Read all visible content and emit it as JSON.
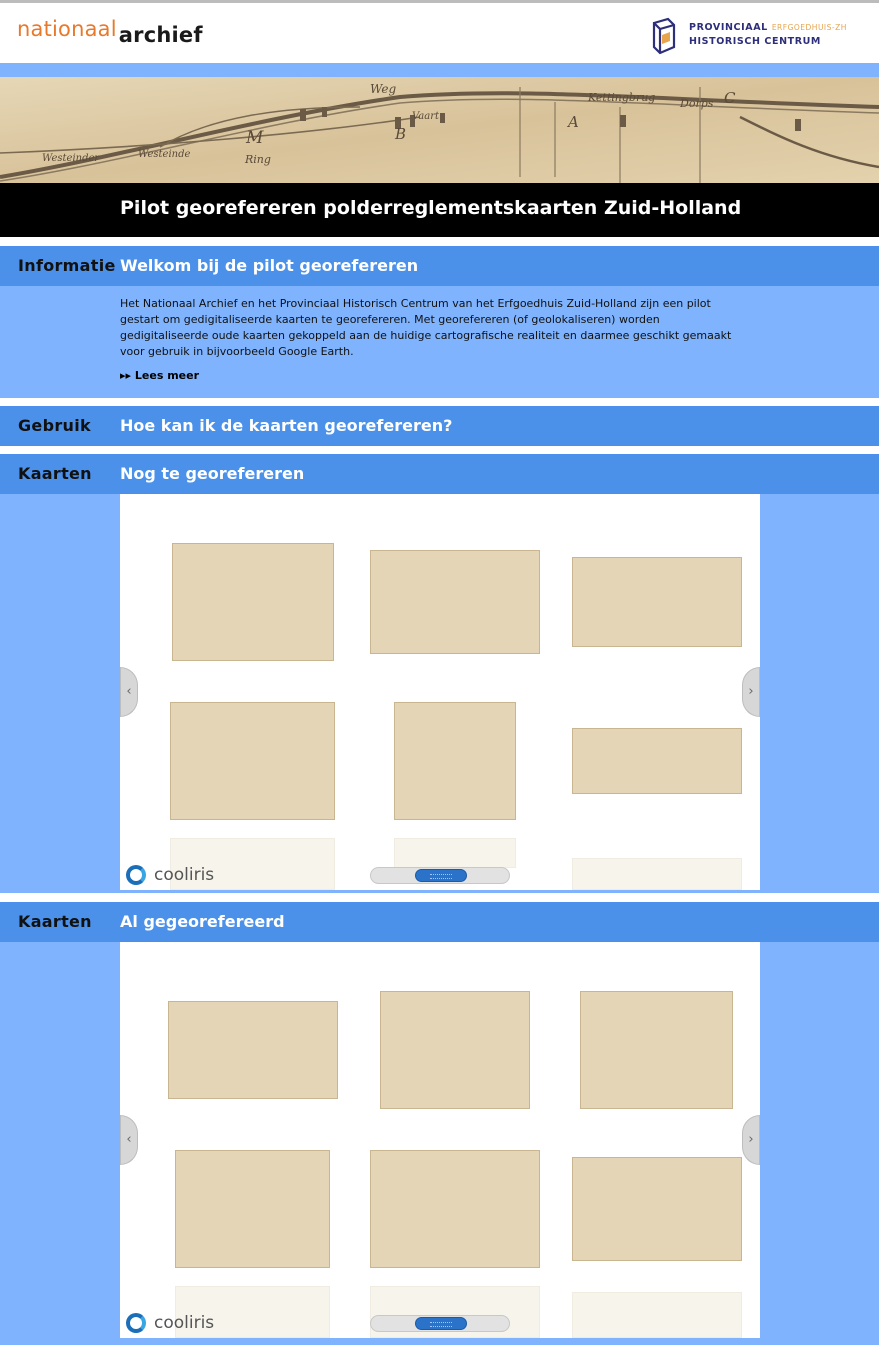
{
  "header": {
    "logo_part1": "nationaal",
    "logo_part2": "archief",
    "partner_line1": "PROVINCIAAL",
    "partner_sub": "ERFGOEDHUIS-ZH",
    "partner_line2": "HISTORISCH CENTRUM"
  },
  "banner": {
    "map_words": [
      "Weg",
      "Vaart",
      "Kettingbrug",
      "Dorps",
      "Westeinder",
      "Westeinde",
      "Ring"
    ]
  },
  "page_title": "Pilot georefereren polderreglementskaarten Zuid-Holland",
  "info": {
    "label": "Informatie",
    "title": "Welkom bij de pilot georefereren",
    "body": "Het Nationaal Archief en het Provinciaal Historisch Centrum van het Erfgoedhuis Zuid-Holland zijn een pilot gestart om gedigitaliseerde kaarten te georefereren. Met georefereren (of geolokaliseren) worden gedigitaliseerde oude kaarten gekoppeld aan de huidige cartografische realiteit en daarmee geschikt gemaakt voor gebruik in bijvoorbeeld Google Earth.",
    "read_more": "Lees meer"
  },
  "usage": {
    "label": "Gebruik",
    "title": "Hoe kan ik de kaarten georefereren?"
  },
  "maps_todo": {
    "label": "Kaarten",
    "title": "Nog te georefereren"
  },
  "maps_done": {
    "label": "Kaarten",
    "title": "Al gegeorefereerd"
  },
  "wall": {
    "brand": "cooliris",
    "prev_glyph": "‹",
    "next_glyph": "›",
    "read_more_glyph": "▸▸"
  },
  "colors": {
    "accent_orange": "#e8792b",
    "band_light": "#7fb3fd",
    "band_mid": "#4b91ea",
    "partner_navy": "#2d2f7a"
  }
}
